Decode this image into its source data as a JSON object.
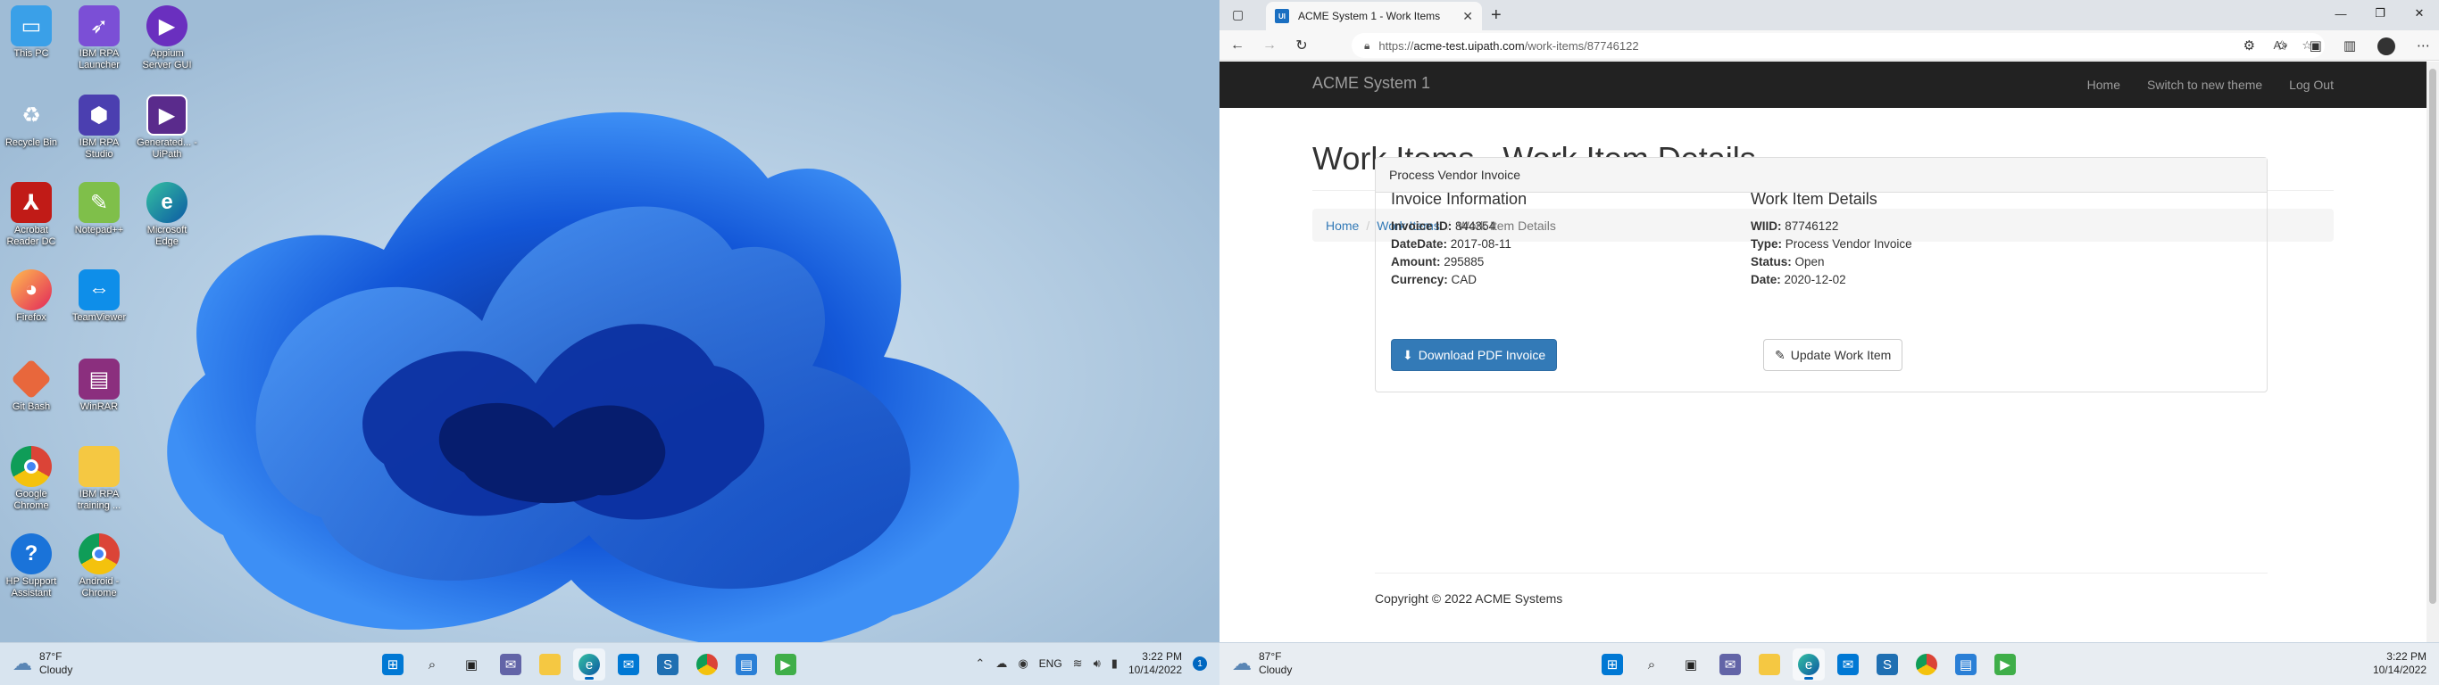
{
  "desktop": {
    "icons": [
      {
        "label": "This PC",
        "icon": "monitor-icon"
      },
      {
        "label": "IBM RPA Launcher",
        "icon": "rocket-icon"
      },
      {
        "label": "Appium Server GUI",
        "icon": "appium-icon"
      },
      {
        "label": "Recycle Bin",
        "icon": "recycle-bin-icon"
      },
      {
        "label": "IBM RPA Studio",
        "icon": "hexagon-icon"
      },
      {
        "label": "Generated... - UiPath",
        "icon": "uipath-icon"
      },
      {
        "label": "Acrobat Reader DC",
        "icon": "pdf-icon"
      },
      {
        "label": "Notepad++",
        "icon": "notepad-plus-icon"
      },
      {
        "label": "Microsoft Edge",
        "icon": "edge-icon"
      },
      {
        "label": "Firefox",
        "icon": "firefox-icon"
      },
      {
        "label": "TeamViewer",
        "icon": "teamviewer-icon"
      },
      {
        "label": "Git Bash",
        "icon": "git-icon"
      },
      {
        "label": "WinRAR",
        "icon": "winrar-icon"
      },
      {
        "label": "Google Chrome",
        "icon": "chrome-icon"
      },
      {
        "label": "IBM RPA training ...",
        "icon": "folder-icon"
      },
      {
        "label": "HP Support Assistant",
        "icon": "help-icon"
      },
      {
        "label": "Android - Chrome",
        "icon": "chrome-icon"
      }
    ]
  },
  "taskbar": {
    "weather_temp": "87°F",
    "weather_desc": "Cloudy",
    "time": "3:22 PM",
    "date": "10/14/2022",
    "lang": "ENG",
    "notif_count": "1"
  },
  "browser": {
    "tab_title": "ACME System 1 - Work Items",
    "favicon_text": "UI",
    "url_prefix": "https://",
    "url_host": "acme-test.uipath.com",
    "url_path": "/work-items/87746122"
  },
  "site": {
    "brand": "ACME System 1",
    "nav": [
      "Home",
      "Switch to new theme",
      "Log Out"
    ],
    "page_title": "Work Items - Work Item Details",
    "breadcrumb": [
      "Home",
      "Work Items",
      "Work Item Details"
    ],
    "panel_title": "Process Vendor Invoice",
    "invoice": {
      "heading": "Invoice Information",
      "rows": [
        {
          "k": "Invoice ID:",
          "v": "844354"
        },
        {
          "k": "DateDate:",
          "v": "2017-08-11"
        },
        {
          "k": "Amount:",
          "v": "295885"
        },
        {
          "k": "Currency:",
          "v": "CAD"
        }
      ],
      "button": "Download PDF Invoice"
    },
    "workitem": {
      "heading": "Work Item Details",
      "rows": [
        {
          "k": "WIID:",
          "v": "87746122"
        },
        {
          "k": "Type:",
          "v": "Process Vendor Invoice"
        },
        {
          "k": "Status:",
          "v": "Open"
        },
        {
          "k": "Date:",
          "v": "2020-12-02"
        }
      ],
      "button": "Update Work Item"
    },
    "footer": "Copyright © 2022 ACME Systems"
  }
}
